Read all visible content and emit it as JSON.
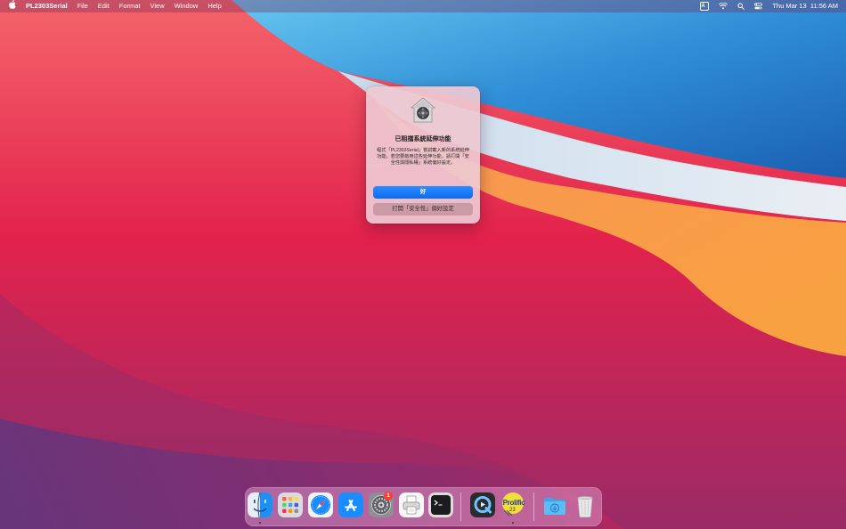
{
  "menubar": {
    "app_name": "PL2303Serial",
    "menus": [
      "File",
      "Edit",
      "Format",
      "View",
      "Window",
      "Help"
    ],
    "input_source": "A",
    "clock": "Thu Mar 13  11:56 AM"
  },
  "dialog": {
    "title": "已阻擋系統延伸功能",
    "message": "程式「PL2303Serial」嘗試載入新的系統延伸功能。若您要啟用這些延伸功能，請打開「安全性與隱私權」系統偏好設定。",
    "ok_label": "好",
    "open_prefs_label": "打開「安全性」偏好設定",
    "icon": "security-lock-icon"
  },
  "dock": {
    "items": [
      {
        "name": "Finder",
        "icon": "finder-icon",
        "running": true
      },
      {
        "name": "Launchpad",
        "icon": "launchpad-icon",
        "running": false
      },
      {
        "name": "Safari",
        "icon": "safari-icon",
        "running": false
      },
      {
        "name": "App Store",
        "icon": "app-store-icon",
        "running": false
      },
      {
        "name": "System Preferences",
        "icon": "system-preferences-icon",
        "running": false
      },
      {
        "name": "Printer Utility",
        "icon": "printer-icon",
        "running": false
      },
      {
        "name": "Terminal",
        "icon": "terminal-icon",
        "running": false
      },
      {
        "name": "QuickTime Player",
        "icon": "quicktime-icon",
        "running": false
      },
      {
        "name": "PL2303Serial",
        "icon": "prolific-icon",
        "running": true
      },
      {
        "name": "Downloads",
        "icon": "downloads-folder-icon",
        "running": false
      },
      {
        "name": "Trash",
        "icon": "trash-icon",
        "running": false
      }
    ],
    "system_prefs_badge": "1",
    "prolific_label": "Prolific",
    "prolific_number": "23"
  },
  "colors": {
    "accent": "#0a6bf0",
    "badge": "#ff3b30"
  }
}
